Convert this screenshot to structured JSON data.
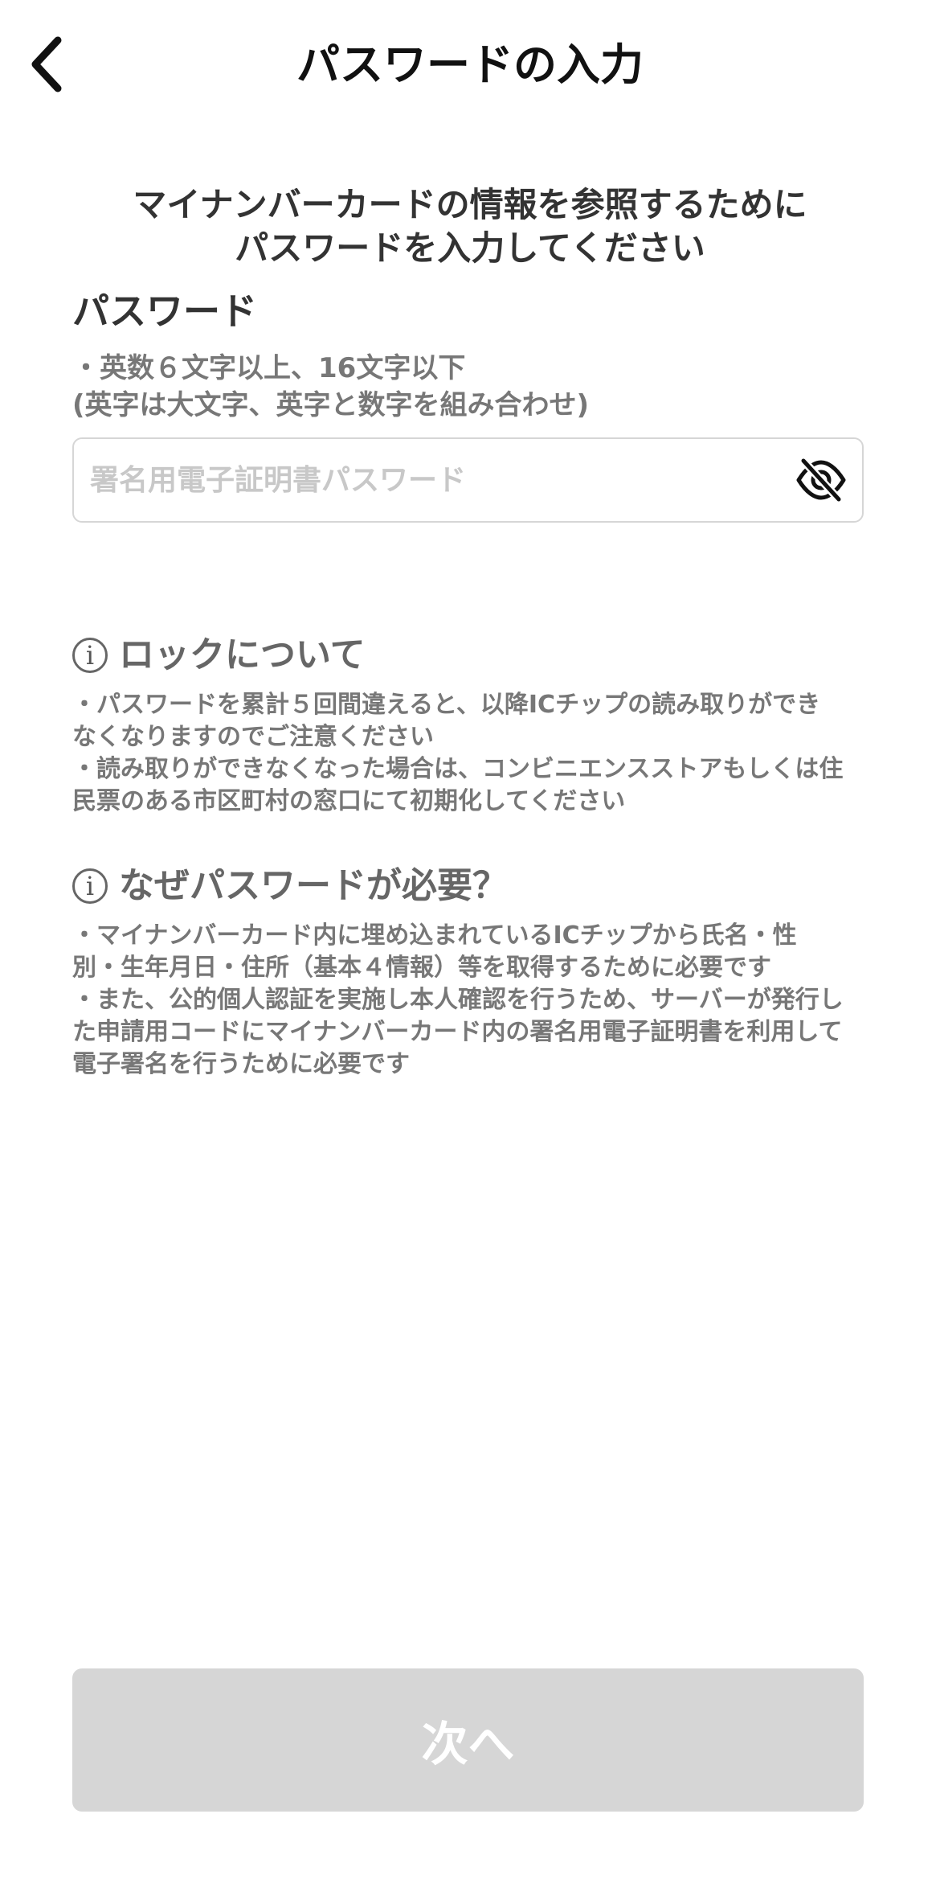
{
  "header": {
    "title": "パスワードの入力",
    "back_icon": "chevron-left-icon"
  },
  "intro": {
    "line1": "マイナンバーカードの情報を参照するために",
    "line2": "パスワードを入力してください"
  },
  "password_field": {
    "label": "パスワード",
    "hint_line1": "・英数６文字以上、16文字以下",
    "hint_line2": "(英字は大文字、英字と数字を組み合わせ)",
    "placeholder": "署名用電子証明書パスワード",
    "value": "",
    "toggle_icon": "eye-slash-icon"
  },
  "lock_section": {
    "icon": "info-icon",
    "title": "ロックについて",
    "lines": [
      "・パスワードを累計５回間違えると、以降ICチップの読み取りができ",
      "なくなりますのでご注意ください",
      "・読み取りができなくなった場合は、コンビニエンスストアもしくは住",
      "民票のある市区町村の窓口にて初期化してください"
    ]
  },
  "why_section": {
    "icon": "info-icon",
    "title": "なぜパスワードが必要？",
    "lines": [
      "・マイナンバーカード内に埋め込まれているICチップから氏名・性",
      "別・生年月日・住所（基本４情報）等を取得するために必要です",
      "・また、公的個人認証を実施し本人確認を行うため、サーバーが発行し",
      "た申請用コードにマイナンバーカード内の署名用電子証明書を利用して",
      "電子署名を行うために必要です"
    ]
  },
  "footer": {
    "next_label": "次へ",
    "next_enabled": false
  },
  "colors": {
    "text_dark": "#111111",
    "text_muted": "#777777",
    "border": "#d6d6d6",
    "button_disabled_bg": "#d6d6d6"
  }
}
